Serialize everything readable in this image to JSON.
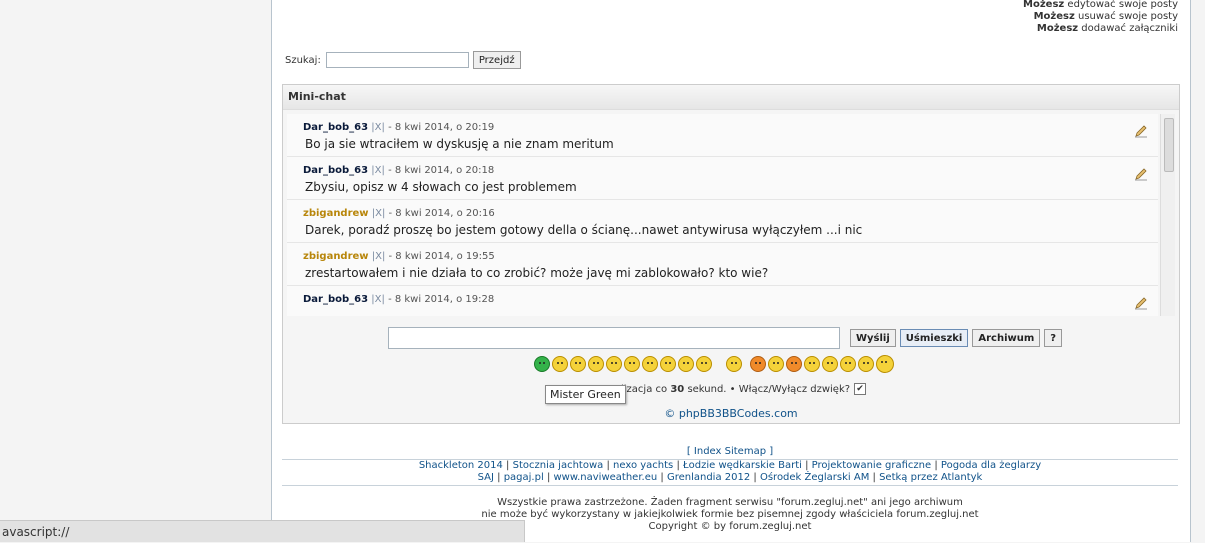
{
  "permissions": [
    {
      "bold": "Możesz",
      "text": "edytować swoje posty"
    },
    {
      "bold": "Możesz",
      "text": "usuwać swoje posty"
    },
    {
      "bold": "Możesz",
      "text": "dodawać załączniki"
    }
  ],
  "search": {
    "label": "Szukaj:",
    "value": "",
    "button": "Przejdź"
  },
  "minichat": {
    "title": "Mini-chat",
    "messages": [
      {
        "user": "Dar_bob_63",
        "x": "|X|",
        "date": "- 8 kwi 2014, o 20:19",
        "text": "Bo ja sie wtraciłem w dyskusję a nie znam meritum"
      },
      {
        "user": "Dar_bob_63",
        "x": "|X|",
        "date": "- 8 kwi 2014, o 20:18",
        "text": "Zbysiu, opisz w 4 słowach co jest problemem"
      },
      {
        "user": "zbigandrew",
        "x": "|X|",
        "date": "- 8 kwi 2014, o 20:16",
        "text": "Darek, poradź proszę bo jestem gotowy della o ścianę...nawet antywirusa wyłączyłem ...i nic"
      },
      {
        "user": "zbigandrew",
        "x": "|X|",
        "date": "- 8 kwi 2014, o 19:55",
        "text": "zrestartowałem i nie działa to co zrobić? może javę mi zablokowało? kto wie?"
      },
      {
        "user": "Dar_bob_63",
        "x": "|X|",
        "date": "- 8 kwi 2014, o 19:28",
        "text": ""
      }
    ],
    "input_value": "",
    "buttons": {
      "send": "Wyślij",
      "smilies": "Uśmieszki",
      "archive": "Archiwum",
      "help": "?"
    },
    "tooltip": "Mister Green",
    "refresh_prefix": "lizacja co",
    "refresh_seconds": "30",
    "refresh_suffix": "sekund. • Włącz/Wyłącz dzwięk?",
    "sound_checked": "✔",
    "credit": "© phpBB3BBCodes.com"
  },
  "footer": {
    "index": "[ Index Sitemap ]",
    "links_row1": [
      "Shackleton 2014",
      "Stocznia jachtowa",
      "nexo yachts",
      "Łodzie wędkarskie Barti",
      "Projektowanie graficzne",
      "Pogoda dla żeglarzy"
    ],
    "links_row2": [
      "SAJ",
      "pagaj.pl",
      "www.naviweather.eu",
      "Grenlandia 2012",
      "Ośrodek Żeglarski AM",
      "Setką przez Atlantyk"
    ],
    "sep": "|",
    "rights1": "Wszystkie prawa zastrzeżone. Żaden fragment serwisu \"forum.zegluj.net\" ani jego archiwum",
    "rights2": "nie może być wykorzystany w jakiejkolwiek formie bez pisemnej zgody właściciela forum.zegluj.net",
    "rights3": "Copyright © by forum.zegluj.net"
  },
  "statusbar": "avascript://",
  "colors": {
    "link": "#105289",
    "user_gold": "#b8860b",
    "user_dark": "#0a1a3a"
  }
}
